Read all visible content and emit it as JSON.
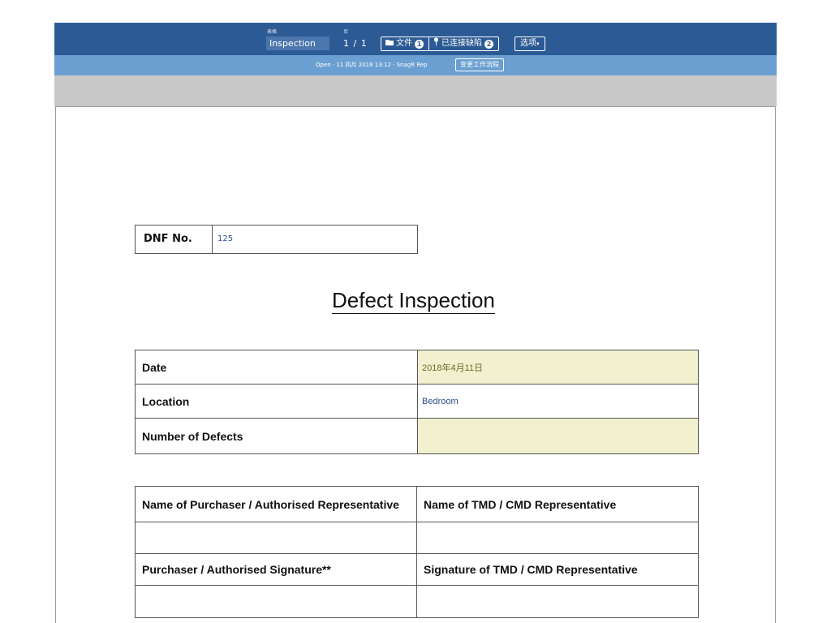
{
  "toolbar": {
    "form_label": "表格",
    "form_value": "Inspection",
    "page_label": "页",
    "page_count": "1 / 1",
    "files_label": "文件",
    "files_count": "1",
    "defects_label": "已连接缺陷",
    "defects_count": "2",
    "options_label": "选项"
  },
  "subbar": {
    "info": "Open · 11 四月 2018 13:12 · SnagR Rep",
    "workflow_button": "变更工作流程"
  },
  "document": {
    "dnf_label": "DNF No.",
    "dnf_value": "125",
    "title": "Defect Inspection",
    "fields": [
      {
        "label": "Date",
        "value": "2018年4月11日"
      },
      {
        "label": "Location",
        "value": "Bedroom"
      },
      {
        "label": "Number of Defects",
        "value": ""
      }
    ],
    "signatures": {
      "purchaser_name": "Name of Purchaser / Authorised Representative",
      "tmd_name": "Name of TMD / CMD Representative",
      "purchaser_signature": "Purchaser / Authorised Signature**",
      "tmd_signature": "Signature of TMD / CMD Representative"
    }
  },
  "colors": {
    "topbar": "#2c5a94",
    "subbar": "#6b9fd1",
    "highlight": "#f1f0cf",
    "value_text": "#2a4f86"
  }
}
